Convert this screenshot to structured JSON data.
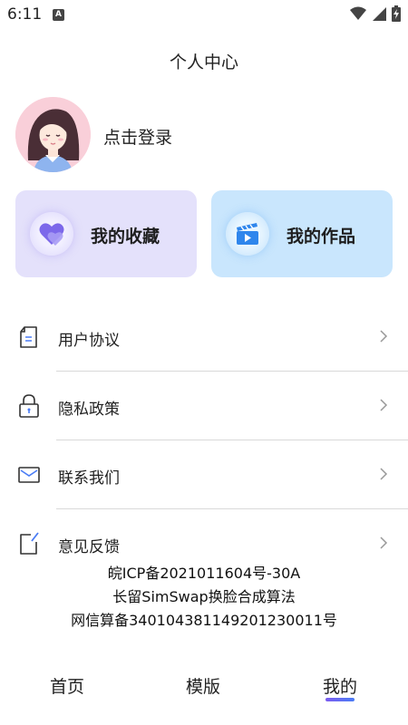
{
  "status": {
    "time": "6:11",
    "notification_letter": "A"
  },
  "header": {
    "title": "个人中心"
  },
  "profile": {
    "login_text": "点击登录"
  },
  "cards": {
    "favorites": {
      "label": "我的收藏",
      "icon": "heart-icon"
    },
    "works": {
      "label": "我的作品",
      "icon": "clapperboard-icon"
    }
  },
  "menu": {
    "items": [
      {
        "label": "用户协议",
        "icon": "document-icon"
      },
      {
        "label": "隐私政策",
        "icon": "lock-icon"
      },
      {
        "label": "联系我们",
        "icon": "mail-icon"
      },
      {
        "label": "意见反馈",
        "icon": "feedback-icon"
      }
    ]
  },
  "footer": {
    "line1": "皖ICP备2021011604号-30A",
    "line2": "长留SimSwap换脸合成算法",
    "line3": "网信算备340104381149201230011号"
  },
  "tabbar": {
    "tabs": [
      {
        "label": "首页"
      },
      {
        "label": "模版"
      },
      {
        "label": "我的"
      }
    ],
    "active_index": 2
  },
  "colors": {
    "favorites_card_bg": "#e4e1fb",
    "works_card_bg": "#c9e6fd",
    "accent": "#6a5cf0"
  }
}
